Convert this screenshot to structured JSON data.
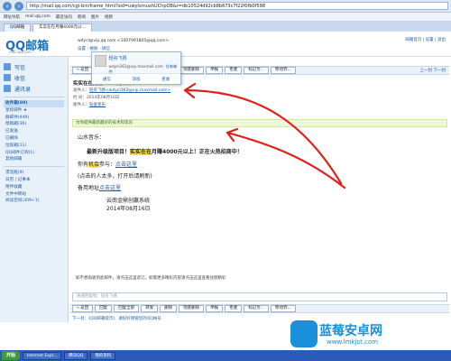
{
  "browser": {
    "url": "http://mail.qq.com/cgi-bin/frame_html?sid=uwyIxmuxhUChpOB&r=db10524d92cb8b673c7f22f0fb0f598",
    "bookmarks": [
      "网址导航",
      "mail.qq.com",
      "最近访问",
      "新闻",
      "图片",
      "视频"
    ],
    "tabs": [
      "QQ邮箱",
      "实实在在月赚4000元以..."
    ]
  },
  "header": {
    "logo": "QQ邮箱",
    "logo_sub": "mail.qq.com",
    "user_line": "wdycl@vip.qq.com <1007991805@qq.com>",
    "user_links": "设置 - 换肤 - 微信",
    "top_links": "邮箱首页 | 设置 | 退出"
  },
  "sidebar": {
    "write": "写信",
    "receive": "收信",
    "contacts": "通讯录",
    "items": [
      "收件箱(89)",
      "星标邮件 ★",
      "群邮件(449)",
      "草稿箱(36)",
      "已发送",
      "已删除",
      "垃圾箱(11)",
      "QQ邮件订阅(1)",
      "其他邮箱",
      "漂流瓶(9)",
      "日历 | 记事本",
      "附件收藏",
      "文件中转站",
      "阅读空间(309+1)"
    ]
  },
  "toolbar": {
    "buttons": [
      "« 返回",
      "回复",
      "回复全部",
      "转发",
      "删除",
      "彻底删除",
      "举报",
      "拒收",
      "标记为...",
      "移动到..."
    ],
    "right": "上一封 下一封"
  },
  "message": {
    "subject": "实实在在月赚4000元以上！",
    "from_label": "发件人：",
    "from": "轻舟飞扬<wdycl363@vip.maxmail.com>",
    "time_label": "时 间：",
    "time": "2014年08月16日",
    "to_label": "收件人：",
    "to": "钻查星乐",
    "banner": "为你提供最新最好的技术和资讯"
  },
  "popup": {
    "name": "轻舟飞扬",
    "email": "wdycl363@vip.maxmail.com",
    "link": "往来邮件",
    "actions": [
      "通信",
      "添加",
      "拒收"
    ]
  },
  "body": {
    "greeting": "山水音乐：",
    "line1_prefix": "最新升级版项目！",
    "line1_hl": "实实在在",
    "line1_mid": "月赚4000元以上！",
    "line1_suffix": "正在火热招商中！",
    "line2_prefix": "你有",
    "line2_hl": "机会",
    "line2_mid": "参与：",
    "line2_link": "点击这里",
    "line3": "(点击的人太多，打开后请刷新)",
    "line4_prefix": "备用地址",
    "line4_link": "点击这里",
    "sig1": "云南金鼎创赢系统",
    "sig2": "2014年08月16日",
    "hint": "如不想再收到此邮件，请点击这里退订，如需更多精彩内容请点击这里查看往期精彩"
  },
  "reply": {
    "placeholder": "快速回复给：轻舟飞扬"
  },
  "bottom": {
    "buttons": [
      "« 返回",
      "回复",
      "回复全部",
      "转发",
      "删除",
      "彻底删除",
      "举报",
      "拒收",
      "标记为...",
      "移动到..."
    ],
    "next": "下一封：《QQ邮箱提示》 请好好保管您的QQ帐号"
  },
  "taskbar": {
    "start": "开始",
    "tasks": [
      "Internet Expl...",
      "腾讯QQ",
      "我的资料"
    ]
  },
  "watermark": {
    "name": "蓝莓安卓网",
    "url": "www.lmkjst.com"
  }
}
